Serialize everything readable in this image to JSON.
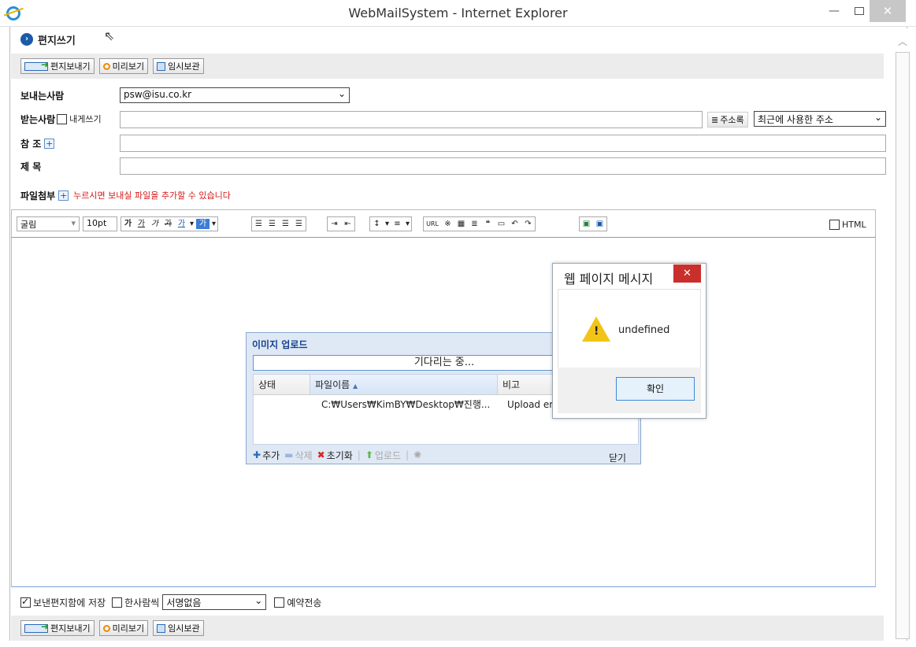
{
  "window": {
    "title": "WebMailSystem - Internet Explorer",
    "minimize": "—",
    "close": "✕"
  },
  "page": {
    "title": "편지쓰기"
  },
  "toolbar": {
    "send": "편지보내기",
    "preview": "미리보기",
    "draft": "임시보관"
  },
  "form": {
    "sender_label": "보내는사람",
    "sender_value": "psw@isu.co.kr",
    "recipient_label": "받는사람",
    "self_send_label": "내게쓰기",
    "recipient_value": "",
    "address_book": "주소록",
    "recent_address": "최근에 사용한 주소",
    "cc_label": "참 조",
    "cc_value": "",
    "subject_label": "제 목",
    "subject_value": "",
    "attach_label": "파일첨부",
    "attach_note": "누르시면 보내실 파일을 추가할 수 있습니다"
  },
  "editor": {
    "font": "굴림",
    "size": "10pt",
    "html_label": "HTML",
    "url_button": "URL"
  },
  "options": {
    "save_sent": "보낸편지함에 저장",
    "save_sent_checked": true,
    "individual": "한사람씩",
    "signature": "서명없음",
    "scheduled": "예약전송"
  },
  "upload": {
    "title": "이미지 업로드",
    "progress": "기다리는 중...",
    "columns": [
      "상태",
      "파일이름",
      "비고"
    ],
    "rows": [
      {
        "status": "",
        "filename": "C:₩Users₩KimBY₩Desktop₩진행...",
        "note": "Upload error"
      }
    ],
    "add": "추가",
    "delete": "삭제",
    "reset": "초기화",
    "upload": "업로드",
    "close": "닫기"
  },
  "alert": {
    "title": "웹 페이지 메시지",
    "message": "undefined",
    "ok": "확인"
  }
}
